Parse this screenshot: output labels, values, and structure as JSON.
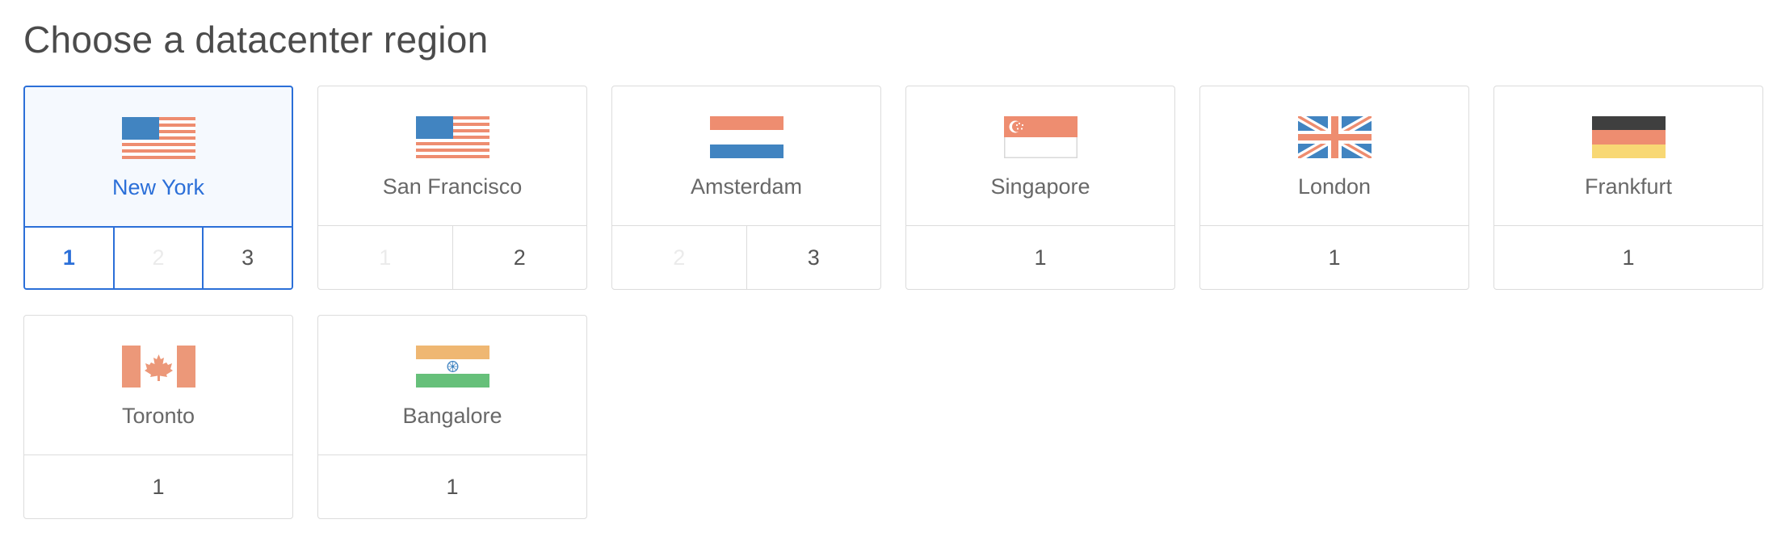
{
  "page": {
    "title": "Choose a datacenter region"
  },
  "colors": {
    "accent": "#2b6fd8",
    "border": "#dcdcdc",
    "selected_background": "#f5f9fe",
    "disabled_text": "#ebebeb"
  },
  "regions": [
    {
      "name": "New York",
      "flag_icon": "usa-flag-icon",
      "selected": true,
      "datacenters": [
        {
          "label": "1",
          "state": "active"
        },
        {
          "label": "2",
          "state": "disabled"
        },
        {
          "label": "3",
          "state": "available"
        }
      ]
    },
    {
      "name": "San Francisco",
      "flag_icon": "usa-flag-icon",
      "selected": false,
      "datacenters": [
        {
          "label": "1",
          "state": "disabled"
        },
        {
          "label": "2",
          "state": "available"
        }
      ]
    },
    {
      "name": "Amsterdam",
      "flag_icon": "netherlands-flag-icon",
      "selected": false,
      "datacenters": [
        {
          "label": "2",
          "state": "disabled"
        },
        {
          "label": "3",
          "state": "available"
        }
      ]
    },
    {
      "name": "Singapore",
      "flag_icon": "singapore-flag-icon",
      "selected": false,
      "datacenters": [
        {
          "label": "1",
          "state": "available"
        }
      ]
    },
    {
      "name": "London",
      "flag_icon": "uk-flag-icon",
      "selected": false,
      "datacenters": [
        {
          "label": "1",
          "state": "available"
        }
      ]
    },
    {
      "name": "Frankfurt",
      "flag_icon": "germany-flag-icon",
      "selected": false,
      "datacenters": [
        {
          "label": "1",
          "state": "available"
        }
      ]
    },
    {
      "name": "Toronto",
      "flag_icon": "canada-flag-icon",
      "selected": false,
      "datacenters": [
        {
          "label": "1",
          "state": "available"
        }
      ]
    },
    {
      "name": "Bangalore",
      "flag_icon": "india-flag-icon",
      "selected": false,
      "datacenters": [
        {
          "label": "1",
          "state": "available"
        }
      ]
    }
  ]
}
